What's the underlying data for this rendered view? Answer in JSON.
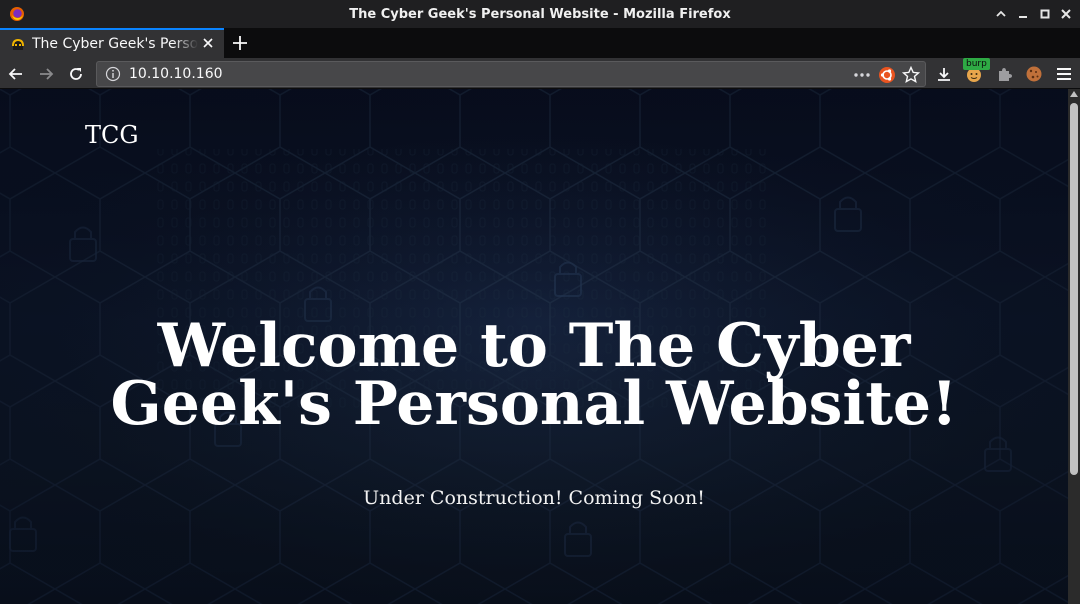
{
  "window": {
    "title": "The Cyber Geek's Personal Website - Mozilla Firefox"
  },
  "tab": {
    "title": "The Cyber Geek's Personal Website"
  },
  "navbar": {
    "url": "10.10.10.160"
  },
  "extensions": {
    "burp_badge": "burp"
  },
  "page": {
    "brand": "TCG",
    "hero_line1": "Welcome to The Cyber",
    "hero_line2": "Geek's Personal Website!",
    "subtitle": "Under Construction! Coming Soon!"
  },
  "colors": {
    "accent": "#0a84ff",
    "page_background": "#0f1a30",
    "burp_badge": "#2eaa44"
  },
  "icons": {
    "titlebar": [
      "firefox-logo-icon",
      "minimize-icon",
      "maximize-icon",
      "restore-icon",
      "close-window-icon"
    ],
    "navbar": [
      "back-icon",
      "forward-icon",
      "reload-icon",
      "info-icon",
      "page-actions-icon",
      "ubuntu-icon",
      "bookmark-star-icon",
      "download-icon",
      "burp-extension-icon",
      "puzzle-icon",
      "cookie-icon",
      "menu-icon"
    ]
  }
}
